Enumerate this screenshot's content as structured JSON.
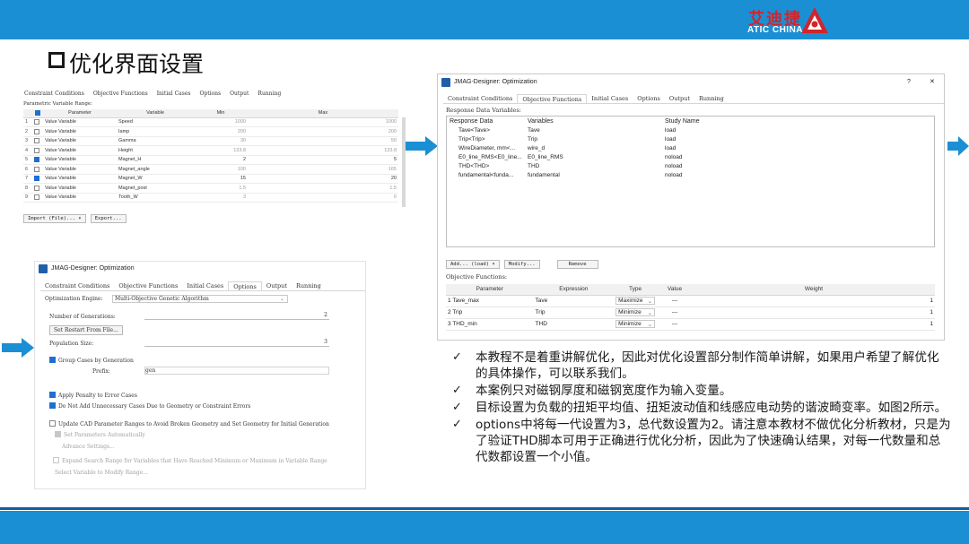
{
  "brand": {
    "name_cn": "艾迪捷",
    "name_en": "ATIC CHINA",
    "accent": "#d0252c",
    "band_color": "#1b8fd4"
  },
  "slide": {
    "title": "优化界面设置"
  },
  "panel_constraints": {
    "tabs": [
      "Constraint Conditions",
      "Objective Functions",
      "Initial Cases",
      "Options",
      "Output",
      "Running"
    ],
    "section_label": "Parametric Variable Range:",
    "columns": [
      "Parameter",
      "Variable",
      "Min",
      "Max"
    ],
    "rows": [
      {
        "n": "1",
        "checked": false,
        "param": "Value Variable",
        "var": "Speed",
        "min": "1000",
        "max": "1000"
      },
      {
        "n": "2",
        "checked": false,
        "param": "Value Variable",
        "var": "Iamp",
        "min": "200",
        "max": "200"
      },
      {
        "n": "3",
        "checked": false,
        "param": "Value Variable",
        "var": "Gamma",
        "min": "30",
        "max": "50"
      },
      {
        "n": "4",
        "checked": false,
        "param": "Value Variable",
        "var": "Height",
        "min": "133.8",
        "max": "133.8"
      },
      {
        "n": "5",
        "checked": true,
        "param": "Value Variable",
        "var": "Magnet_H",
        "min": "2",
        "max": "5"
      },
      {
        "n": "6",
        "checked": false,
        "param": "Value Variable",
        "var": "Magnet_angle",
        "min": "100",
        "max": "165"
      },
      {
        "n": "7",
        "checked": true,
        "param": "Value Variable",
        "var": "Magnet_W",
        "min": "15",
        "max": "20"
      },
      {
        "n": "8",
        "checked": false,
        "param": "Value Variable",
        "var": "Magnet_post",
        "min": "1.5",
        "max": "1.5"
      },
      {
        "n": "9",
        "checked": false,
        "param": "Value Variable",
        "var": "Tooth_W",
        "min": "3",
        "max": "6"
      }
    ],
    "import_button": "Import (File)... ▾",
    "export_button": "Export..."
  },
  "panel_objectives": {
    "window_title": "JMAG-Designer: Optimization",
    "help_glyph": "?",
    "close_glyph": "✕",
    "tabs": [
      "Constraint Conditions",
      "Objective Functions",
      "Initial Cases",
      "Options",
      "Output",
      "Running"
    ],
    "response_label": "Response Data Variables:",
    "response_columns": [
      "Response Data",
      "Variables",
      "Study Name"
    ],
    "response_rows": [
      {
        "data": "Tave<Tave>",
        "variable": "Tave",
        "study": "load"
      },
      {
        "data": "Trip<Trip>",
        "variable": "Trip",
        "study": "load"
      },
      {
        "data": "WireDiameter, mm<...",
        "variable": "wire_d",
        "study": "load"
      },
      {
        "data": "E0_line_RMS<E0_line...",
        "variable": "E0_line_RMS",
        "study": "noload"
      },
      {
        "data": "THD<THD>",
        "variable": "THD",
        "study": "noload"
      },
      {
        "data": "fundamental<funda...",
        "variable": "fundamental",
        "study": "noload"
      }
    ],
    "add_button": "Add... (load) ▾",
    "modify_button": "Modify...",
    "remove_button": "Remove",
    "objective_label": "Objective Functions:",
    "objective_columns": [
      "Parameter",
      "Expression",
      "Type",
      "Value",
      "Weight"
    ],
    "objective_rows": [
      {
        "n": "1",
        "param": "Tave_max",
        "expr": "Tave",
        "type": "Maximize",
        "value": "---",
        "weight": "1"
      },
      {
        "n": "2",
        "param": "Trip",
        "expr": "Trip",
        "type": "Minimize",
        "value": "---",
        "weight": "1"
      },
      {
        "n": "3",
        "param": "THD_min",
        "expr": "THD",
        "type": "Minimize",
        "value": "---",
        "weight": "1"
      }
    ]
  },
  "panel_options": {
    "window_title": "JMAG-Designer: Optimization",
    "tabs": [
      "Constraint Conditions",
      "Objective Functions",
      "Initial Cases",
      "Options",
      "Output",
      "Running"
    ],
    "engine_label": "Optimization Engine:",
    "engine_value": "Multi-Objective Genetic Algorithm",
    "generations_label": "Number of Generations:",
    "generations_value": "2",
    "restart_button": "Set Restart From File...",
    "population_label": "Population Size:",
    "population_value": "3",
    "group_cases_label": "Group Cases by Generation",
    "prefix_label": "Prefix:",
    "prefix_value": "gen",
    "penalty_label": "Apply Penalty to Error Cases",
    "no_unnecessary_label": "Do Not Add Unnecessary Cases Due to Geometry or Constraint Errors",
    "update_cad_label": "Update CAD Parameter Ranges to Avoid Broken Geometry and Set Geometry for Initial Generation",
    "set_params_label": "Set Parameters Automatically",
    "advance_button": "Advance Settings...",
    "expand_label": "Expand Search Range for Variables that Have Reached Minimum or Maximum in Variable Range",
    "select_variable_button": "Select Variable to Modify Range..."
  },
  "notes": [
    "本教程不是着重讲解优化，因此对优化设置部分制作简单讲解，如果用户希望了解优化的具体操作，可以联系我们。",
    "本案例只对磁钢厚度和磁钢宽度作为输入变量。",
    "目标设置为负载的扭矩平均值、扭矩波动值和线感应电动势的谐波畸变率。如图2所示。",
    "options中将每一代设置为3，总代数设置为2。请注意本教材不做优化分析教材，只是为了验证THD脚本可用于正确进行优化分析，因此为了快速确认结果，对每一代数量和总代数都设置一个小值。"
  ],
  "icons": {
    "bullet": "check-icon",
    "arrow": "right-arrow-icon"
  },
  "colors": {
    "arrow": "#1b8fd4",
    "checkbox_on": "#1f6fd1"
  }
}
